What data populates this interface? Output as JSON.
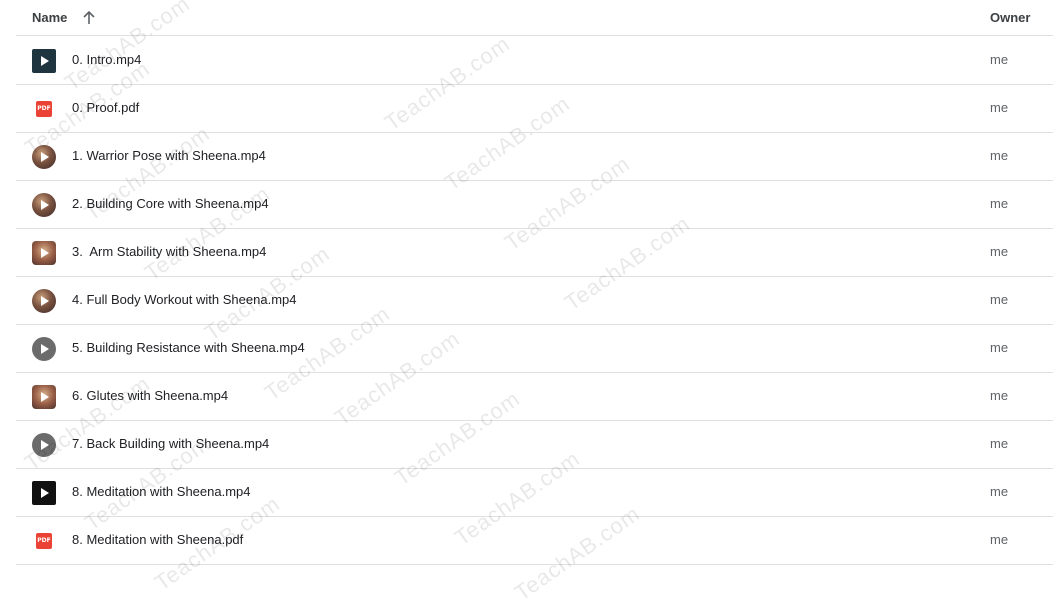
{
  "header": {
    "name_label": "Name",
    "owner_label": "Owner"
  },
  "files": [
    {
      "name": "0. Intro.mp4",
      "owner": "me",
      "icon": "video-icon"
    },
    {
      "name": "0. Proof.pdf",
      "owner": "me",
      "icon": "pdf-icon"
    },
    {
      "name": "1. Warrior Pose with Sheena.mp4",
      "owner": "me",
      "icon": "video-thumbnail-icon"
    },
    {
      "name": "2. Building Core with Sheena.mp4",
      "owner": "me",
      "icon": "video-thumbnail-icon"
    },
    {
      "name": "3.  Arm Stability with Sheena.mp4",
      "owner": "me",
      "icon": "video-thumbnail-icon"
    },
    {
      "name": "4. Full Body Workout with Sheena.mp4",
      "owner": "me",
      "icon": "video-thumbnail-icon"
    },
    {
      "name": "5. Building Resistance with Sheena.mp4",
      "owner": "me",
      "icon": "video-thumbnail-icon"
    },
    {
      "name": "6. Glutes with Sheena.mp4",
      "owner": "me",
      "icon": "video-thumbnail-icon"
    },
    {
      "name": "7. Back Building with Sheena.mp4",
      "owner": "me",
      "icon": "video-thumbnail-icon"
    },
    {
      "name": "8. Meditation with Sheena.mp4",
      "owner": "me",
      "icon": "video-icon"
    },
    {
      "name": "8. Meditation with Sheena.pdf",
      "owner": "me",
      "icon": "pdf-icon"
    }
  ],
  "watermark": "TeachAB.com",
  "colors": {
    "text": "#202124",
    "secondary_text": "#5f6368",
    "divider": "#e0e0e0",
    "pdf_red": "#ea4335"
  }
}
